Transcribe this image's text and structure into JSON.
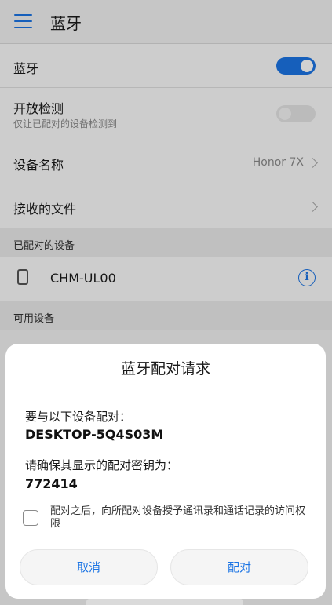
{
  "header": {
    "title": "蓝牙",
    "menu_icon": "hamburger-menu-icon"
  },
  "settings": {
    "bluetooth": {
      "label": "蓝牙",
      "enabled": true
    },
    "visibility": {
      "label": "开放检测",
      "sub": "仅让已配对的设备检测到",
      "enabled": false
    },
    "device_name": {
      "label": "设备名称",
      "value": "Honor 7X"
    },
    "received_files": {
      "label": "接收的文件"
    }
  },
  "paired": {
    "header": "已配对的设备",
    "devices": [
      {
        "name": "CHM-UL00",
        "icon": "phone-icon",
        "info_icon": "info-icon"
      }
    ]
  },
  "available": {
    "header": "可用设备"
  },
  "dialog": {
    "title": "蓝牙配对请求",
    "pair_with_label": "要与以下设备配对：",
    "device": "DESKTOP-5Q4S03M",
    "confirm_label": "请确保其显示的配对密钥为：",
    "passkey": "772414",
    "checkbox_label": "配对之后，向所配对设备授予通讯录和通话记录的访问权限",
    "checkbox_checked": false,
    "cancel": "取消",
    "pair": "配对"
  },
  "colors": {
    "accent": "#1b74e4",
    "background": "#f2f2f2"
  }
}
